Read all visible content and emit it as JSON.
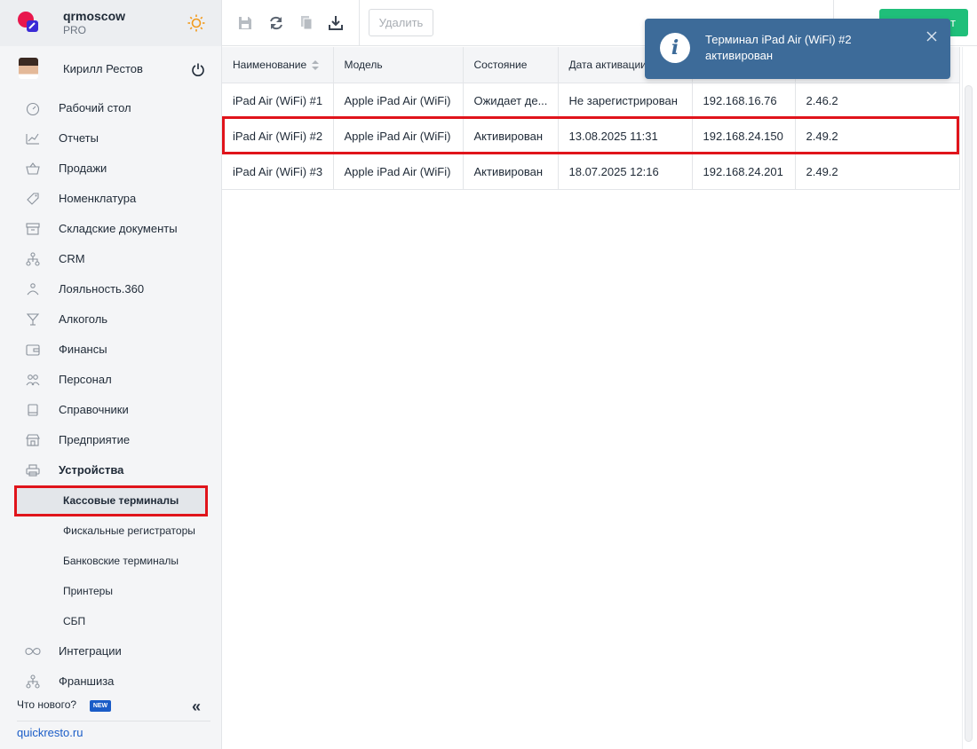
{
  "brand": {
    "name": "qrmoscow",
    "plan": "PRO"
  },
  "user": {
    "name": "Кирилл Рестов"
  },
  "nav": [
    {
      "label": "Рабочий стол",
      "icon": "gauge-icon"
    },
    {
      "label": "Отчеты",
      "icon": "chart-icon"
    },
    {
      "label": "Продажи",
      "icon": "basket-icon"
    },
    {
      "label": "Номенклатура",
      "icon": "tag-icon"
    },
    {
      "label": "Складские документы",
      "icon": "archive-icon"
    },
    {
      "label": "CRM",
      "icon": "hierarchy-icon"
    },
    {
      "label": "Лояльность.360",
      "icon": "loyalty-icon"
    },
    {
      "label": "Алкоголь",
      "icon": "cocktail-icon"
    },
    {
      "label": "Финансы",
      "icon": "wallet-icon"
    },
    {
      "label": "Персонал",
      "icon": "people-icon"
    },
    {
      "label": "Справочники",
      "icon": "book-icon"
    },
    {
      "label": "Предприятие",
      "icon": "store-icon"
    },
    {
      "label": "Устройства",
      "icon": "printer-icon"
    }
  ],
  "subnav": [
    {
      "label": "Кассовые терминалы"
    },
    {
      "label": "Фискальные регистраторы"
    },
    {
      "label": "Банковские терминалы"
    },
    {
      "label": "Принтеры"
    },
    {
      "label": "СБП"
    }
  ],
  "nav_after": [
    {
      "label": "Интеграции",
      "icon": "infinity-icon"
    },
    {
      "label": "Франшиза",
      "icon": "hierarchy-icon"
    }
  ],
  "footer": {
    "whats_new": "Что нового?",
    "badge": "NEW",
    "site": "quickresto.ru"
  },
  "toolbar": {
    "delete_label": "Удалить",
    "green_label": "т"
  },
  "table": {
    "columns": [
      "Наименование",
      "Модель",
      "Состояние",
      "Дата активации",
      "",
      ""
    ],
    "rows": [
      [
        "iPad Air (WiFi) #1",
        "Apple iPad Air (WiFi)",
        "Ожидает де...",
        "Не зарегистрирован",
        "192.168.16.76",
        "2.46.2"
      ],
      [
        "iPad Air (WiFi) #2",
        "Apple iPad Air (WiFi)",
        "Активирован",
        "13.08.2025 11:31",
        "192.168.24.150",
        "2.49.2"
      ],
      [
        "iPad Air (WiFi) #3",
        "Apple iPad Air (WiFi)",
        "Активирован",
        "18.07.2025 12:16",
        "192.168.24.201",
        "2.49.2"
      ]
    ]
  },
  "toast": {
    "text": "Терминал iPad Air (WiFi) #2 активирован"
  },
  "colors": {
    "accent": "#1a5cc7",
    "toast": "#3d6b99",
    "green": "#1fbf7a",
    "highlight": "#e0141b"
  }
}
